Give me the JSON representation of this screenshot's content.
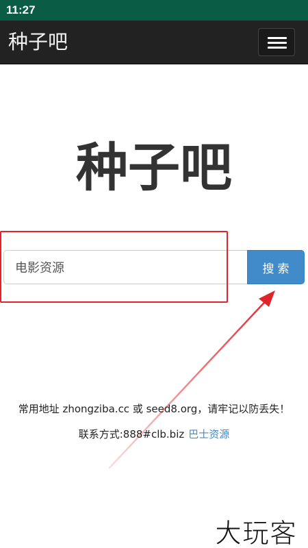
{
  "status_bar": {
    "time": "11:27"
  },
  "navbar": {
    "brand": "种子吧"
  },
  "hero": {
    "title": "种子吧"
  },
  "search": {
    "value": "电影资源",
    "button_label": "搜索"
  },
  "footer": {
    "line1": "常用地址 zhongziba.cc 或 seed8.org，请牢记以防丢失！",
    "contact": "联系方式:888#clb.biz",
    "link_label": "巴士资源"
  },
  "watermark": {
    "text": "大玩客"
  },
  "colors": {
    "status_bar": "#0a5c45",
    "navbar": "#222222",
    "button": "#428bca",
    "link": "#428bca",
    "annotation": "#e0242c"
  }
}
